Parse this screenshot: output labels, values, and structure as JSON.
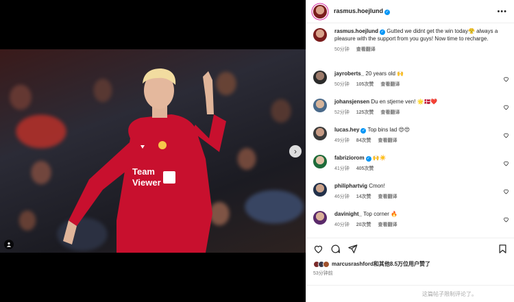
{
  "post": {
    "author": "rasmus.hoejlund",
    "menu_label": "•••"
  },
  "comments": [
    {
      "user": "rasmus.hoejlund",
      "verified": true,
      "text": "Gutted we didnt get the win today😤 always a pleasure with the support from you guys! Now time to recharge.",
      "time": "50分钟",
      "likes": "",
      "translate": "查看翻译",
      "show_heart": false
    },
    {
      "user": "jayroberts_",
      "verified": false,
      "text": "20 years old 🙌",
      "time": "50分钟",
      "likes": "105次赞",
      "translate": "查看翻译",
      "show_heart": true
    },
    {
      "user": "johansjensen",
      "verified": false,
      "text": "Du en stjerne ven! 🌟🇩🇰❤️",
      "time": "52分钟",
      "likes": "125次赞",
      "translate": "查看翻译",
      "show_heart": true
    },
    {
      "user": "lucas.hey",
      "verified": true,
      "text": "Top bins lad 😍😍",
      "time": "49分钟",
      "likes": "84次赞",
      "translate": "查看翻译",
      "show_heart": true
    },
    {
      "user": "fabriziorom",
      "verified": true,
      "text": "🙌☀️",
      "time": "41分钟",
      "likes": "405次赞",
      "translate": "",
      "show_heart": true
    },
    {
      "user": "philiphartvig",
      "verified": false,
      "text": "Cmon!",
      "time": "46分钟",
      "likes": "14次赞",
      "translate": "查看翻译",
      "show_heart": true
    },
    {
      "user": "davinight_",
      "verified": false,
      "text": "Top corner 🔥",
      "time": "40分钟",
      "likes": "20次赞",
      "translate": "查看翻译",
      "show_heart": true
    }
  ],
  "footer": {
    "likes_user": "marcusrashford",
    "likes_suffix": "和其他8.5万位用户赞了",
    "time_ago": "53分钟前",
    "comments_disabled": "这篇帖子限制评论了。"
  },
  "colors": {
    "verified": "#0095f6",
    "shirt": "#c8102e"
  },
  "icons": [
    "more-icon",
    "heart-icon",
    "comment-icon",
    "share-icon",
    "bookmark-icon",
    "chevron-right-icon",
    "user-tag-icon"
  ]
}
